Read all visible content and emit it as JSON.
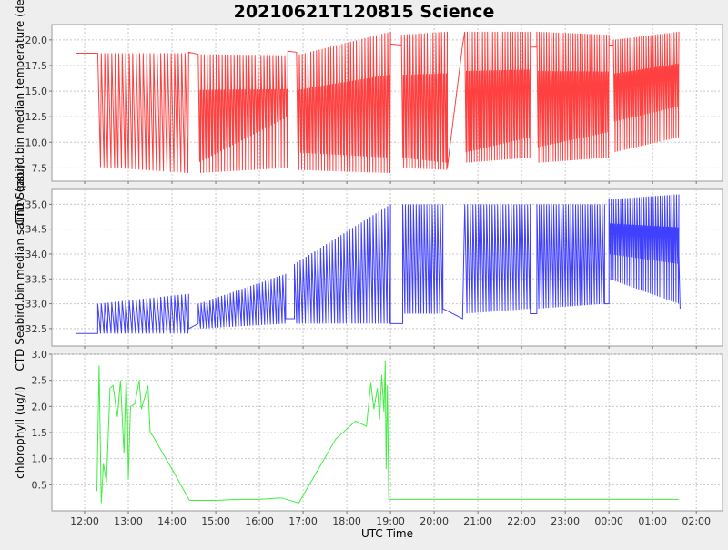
{
  "title": "20210621T120815 Science",
  "chart_data": {
    "type": "line",
    "title": "20210621T120815 Science",
    "xlabel": "UTC Time",
    "x_ticks": [
      "12:00",
      "13:00",
      "14:00",
      "15:00",
      "16:00",
      "17:00",
      "18:00",
      "19:00",
      "20:00",
      "21:00",
      "22:00",
      "23:00",
      "00:00",
      "01:00",
      "02:00"
    ],
    "x_range_hours": [
      11.25,
      26.6
    ],
    "grid": true,
    "panels": [
      {
        "ylabel": "CTD Seabird.bin median temperature (degC)",
        "color": "#ff4040",
        "ylim": [
          6.2,
          21.5
        ],
        "y_ticks": [
          "7.5",
          "10.0",
          "12.5",
          "15.0",
          "17.5",
          "20.0"
        ],
        "y_tick_values": [
          7.5,
          10.0,
          12.5,
          15.0,
          17.5,
          20.0
        ],
        "segments": [
          {
            "x": [
              11.8,
              12.3
            ],
            "y": [
              18.7,
              18.7
            ]
          },
          {
            "x": [
              12.3,
              14.38
            ],
            "y_high": [
              18.7,
              18.7
            ],
            "y_low": [
              7.6,
              7.0
            ],
            "cycles": 26
          },
          {
            "x": [
              14.38,
              14.6
            ],
            "y": [
              18.8,
              18.6
            ]
          },
          {
            "x": [
              14.6,
              16.65
            ],
            "y_high": [
              18.6,
              18.5
            ],
            "y_low": [
              7.0,
              7.5
            ],
            "mid_low": [
              8.0,
              12.5
            ],
            "cycles": 30
          },
          {
            "x": [
              16.65,
              16.85
            ],
            "y": [
              18.9,
              18.8
            ]
          },
          {
            "x": [
              16.85,
              19.0
            ],
            "y_high": [
              18.5,
              20.8
            ],
            "y_low": [
              7.3,
              7.0
            ],
            "mid_low": [
              9.0,
              8.5
            ],
            "cycles": 33
          },
          {
            "x": [
              19.0,
              19.25
            ],
            "y": [
              19.6,
              19.5
            ]
          },
          {
            "x": [
              19.25,
              20.3
            ],
            "y_high": [
              20.5,
              20.8
            ],
            "y_low": [
              7.5,
              7.3
            ],
            "mid_low": [
              8.5,
              8.0
            ],
            "cycles": 16
          },
          {
            "x": [
              20.3,
              20.65
            ],
            "y": [
              7.5,
              19.5
            ]
          },
          {
            "x": [
              20.7,
              22.2
            ],
            "y_high": [
              20.8,
              20.8
            ],
            "y_low": [
              8.0,
              8.5
            ],
            "mid_low": [
              9.0,
              10.5
            ],
            "cycles": 26
          },
          {
            "x": [
              22.2,
              22.35
            ],
            "y": [
              19.3,
              19.3
            ]
          },
          {
            "x": [
              22.35,
              24.0
            ],
            "y_high": [
              20.8,
              20.5
            ],
            "y_low": [
              8.0,
              8.5
            ],
            "mid_low": [
              9.5,
              11.0
            ],
            "cycles": 30
          },
          {
            "x": [
              24.0,
              24.1
            ],
            "y": [
              19.5,
              19.5
            ]
          },
          {
            "x": [
              24.1,
              25.6
            ],
            "y_high": [
              20.0,
              20.8
            ],
            "y_low": [
              9.0,
              10.5
            ],
            "mid_low": [
              12.0,
              13.5
            ],
            "cycles": 28
          }
        ]
      },
      {
        "ylabel": "CTD Seabird.bin median salinity (psu)",
        "color": "#4040ff",
        "ylim": [
          32.15,
          35.3
        ],
        "y_ticks": [
          "32.5",
          "33.0",
          "33.5",
          "34.0",
          "34.5",
          "35.0"
        ],
        "y_tick_values": [
          32.5,
          33.0,
          33.5,
          34.0,
          34.5,
          35.0
        ],
        "segments": [
          {
            "x": [
              11.8,
              12.3
            ],
            "y": [
              32.4,
              32.4
            ]
          },
          {
            "x": [
              12.3,
              14.38
            ],
            "y_high": [
              33.0,
              33.2
            ],
            "y_low": [
              32.4,
              32.4
            ],
            "cycles": 26
          },
          {
            "x": [
              14.38,
              14.6
            ],
            "y": [
              32.5,
              32.6
            ]
          },
          {
            "x": [
              14.6,
              16.6
            ],
            "y_high": [
              33.0,
              33.6
            ],
            "y_low": [
              32.5,
              32.6
            ],
            "cycles": 30
          },
          {
            "x": [
              16.6,
              16.8
            ],
            "y": [
              32.7,
              32.7
            ]
          },
          {
            "x": [
              16.8,
              19.0
            ],
            "y_high": [
              33.8,
              35.0
            ],
            "y_low": [
              32.6,
              32.6
            ],
            "cycles": 33
          },
          {
            "x": [
              19.0,
              19.28
            ],
            "y": [
              32.6,
              32.6
            ]
          },
          {
            "x": [
              19.28,
              20.2
            ],
            "y_high": [
              35.0,
              35.0
            ],
            "y_low": [
              32.8,
              32.8
            ],
            "cycles": 15
          },
          {
            "x": [
              20.2,
              20.65
            ],
            "y": [
              32.9,
              32.7
            ]
          },
          {
            "x": [
              20.7,
              22.2
            ],
            "y_high": [
              35.0,
              35.0
            ],
            "y_low": [
              32.8,
              32.9
            ],
            "cycles": 24
          },
          {
            "x": [
              22.2,
              22.35
            ],
            "y": [
              32.8,
              32.8
            ]
          },
          {
            "x": [
              22.35,
              23.9
            ],
            "y_high": [
              35.0,
              35.0
            ],
            "y_low": [
              32.9,
              33.0
            ],
            "cycles": 28
          },
          {
            "x": [
              23.9,
              24.0
            ],
            "y": [
              33.0,
              33.0
            ]
          },
          {
            "x": [
              24.0,
              25.6
            ],
            "y_high": [
              35.1,
              35.2
            ],
            "y_low": [
              33.5,
              33.0
            ],
            "mid_low": [
              34.0,
              33.8
            ],
            "cycles": 30
          },
          {
            "x": [
              25.6,
              25.63
            ],
            "y": [
              34.0,
              32.9
            ]
          }
        ]
      },
      {
        "ylabel": "chlorophyll (ug/l)",
        "color": "#40ee40",
        "ylim": [
          0.0,
          3.0
        ],
        "y_ticks": [
          "0.5",
          "1.0",
          "1.5",
          "2.0",
          "2.5",
          "3.0"
        ],
        "y_tick_values": [
          0.5,
          1.0,
          1.5,
          2.0,
          2.5,
          3.0
        ],
        "x": [
          12.28,
          12.33,
          12.38,
          12.43,
          12.5,
          12.58,
          12.65,
          12.75,
          12.82,
          12.9,
          12.95,
          12.98,
          13.0,
          13.05,
          13.15,
          13.25,
          13.3,
          13.35,
          13.45,
          13.5,
          13.55,
          14.0,
          14.4,
          15.0,
          15.5,
          16.0,
          16.5,
          16.9,
          17.75,
          18.2,
          18.45,
          18.55,
          18.62,
          18.7,
          18.75,
          18.8,
          18.85,
          18.88,
          18.9,
          18.93,
          18.96,
          19.0,
          20.0,
          22.0,
          24.0,
          25.0,
          25.6
        ],
        "y": [
          0.38,
          2.78,
          0.15,
          0.9,
          0.55,
          2.35,
          2.4,
          1.8,
          2.5,
          1.1,
          2.55,
          1.8,
          0.6,
          2.0,
          2.05,
          2.5,
          1.95,
          2.1,
          2.4,
          1.5,
          1.45,
          0.8,
          0.2,
          0.2,
          0.22,
          0.22,
          0.25,
          0.15,
          1.38,
          1.72,
          1.62,
          2.45,
          1.95,
          2.35,
          1.75,
          2.6,
          1.9,
          2.88,
          0.8,
          2.4,
          0.22,
          0.22,
          0.22,
          0.22,
          0.22,
          0.22,
          0.22
        ]
      }
    ]
  }
}
